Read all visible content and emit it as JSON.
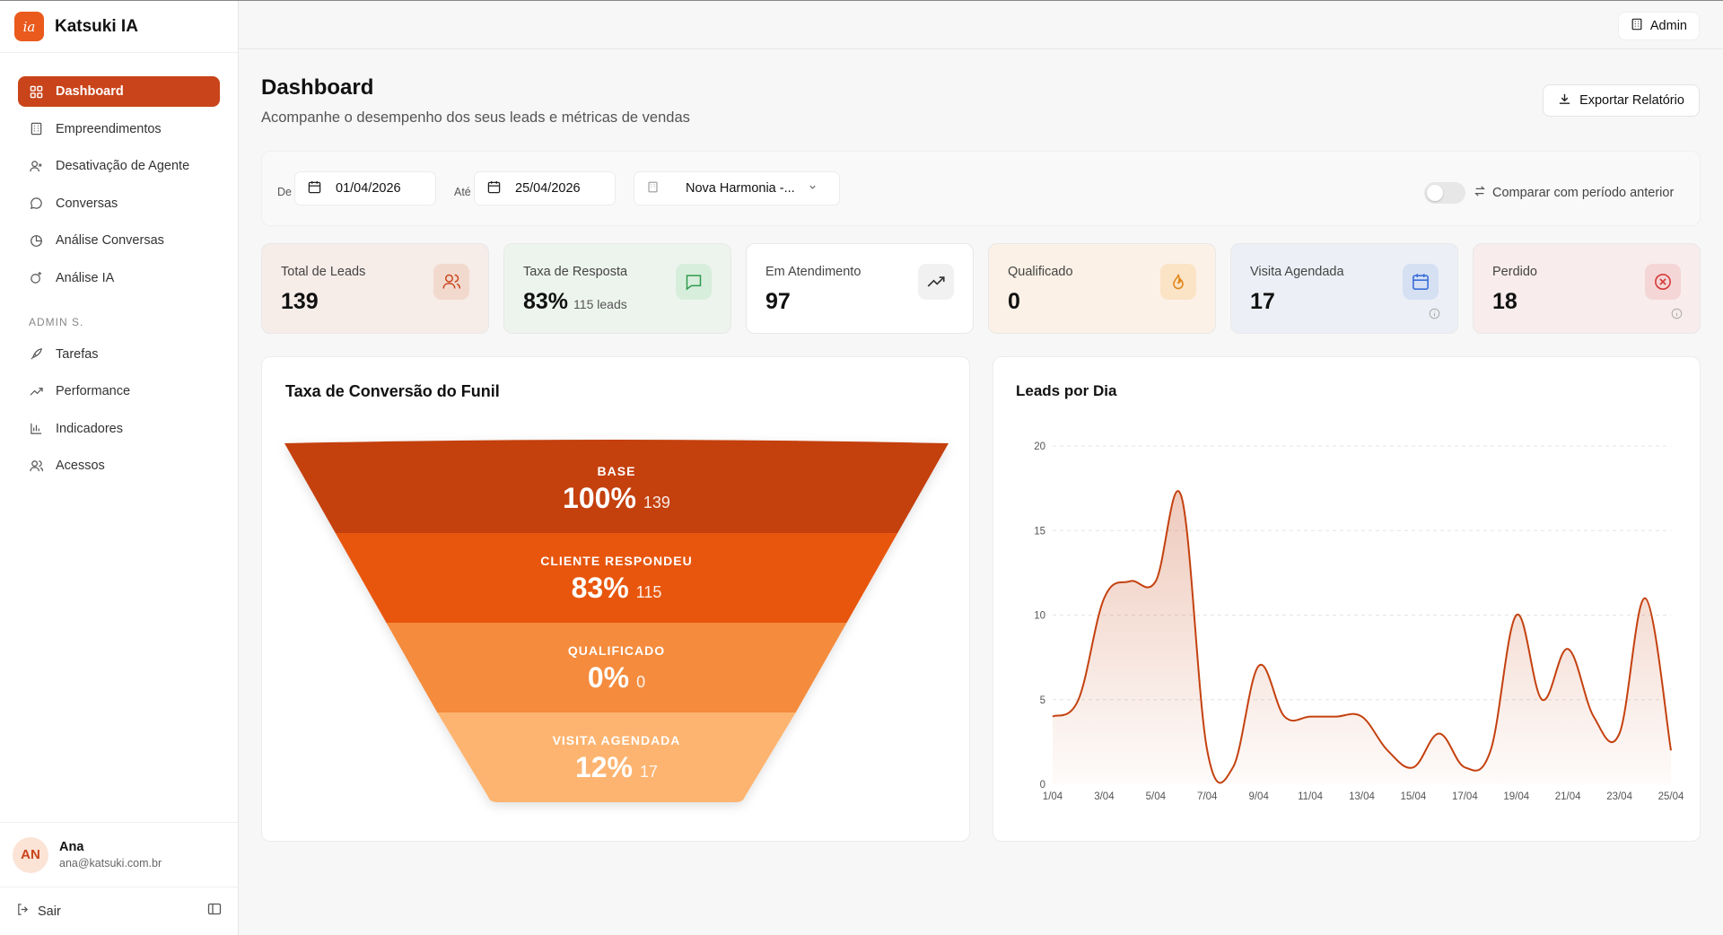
{
  "brand": {
    "logo_text": "ia",
    "name": "Katsuki IA",
    "accent": "#c9441a"
  },
  "sidebar": {
    "items": [
      {
        "label": "Dashboard",
        "icon": "grid-icon",
        "active": true
      },
      {
        "label": "Empreendimentos",
        "icon": "building-icon"
      },
      {
        "label": "Desativação de Agente",
        "icon": "user-x-icon"
      },
      {
        "label": "Conversas",
        "icon": "chat-icon"
      },
      {
        "label": "Análise Conversas",
        "icon": "pie-chart-icon"
      },
      {
        "label": "Análise IA",
        "icon": "sparkle-icon"
      }
    ],
    "admin_section_label": "ADMIN S.",
    "admin_items": [
      {
        "label": "Tarefas",
        "icon": "rocket-icon"
      },
      {
        "label": "Performance",
        "icon": "trend-icon"
      },
      {
        "label": "Indicadores",
        "icon": "bar-chart-icon"
      },
      {
        "label": "Acessos",
        "icon": "users-icon"
      }
    ],
    "user": {
      "initials": "AN",
      "name": "Ana",
      "email": "ana@katsuki.com.br"
    },
    "logout_label": "Sair"
  },
  "header": {
    "admin_label": "Admin"
  },
  "page": {
    "title": "Dashboard",
    "subtitle": "Acompanhe o desempenho dos seus leads e métricas de vendas",
    "export_label": "Exportar Relatório"
  },
  "filters": {
    "from_label": "De",
    "from_value": "01/04/2026",
    "to_label": "Até",
    "to_value": "25/04/2026",
    "project_value": "Nova Harmonia -...",
    "compare_label": "Comparar com período anterior",
    "compare_enabled": false
  },
  "metrics": [
    {
      "label": "Total de Leads",
      "value": "139",
      "sub": "",
      "icon": "users-icon",
      "bg": "#f6ece8",
      "icon_bg": "#f2d9ce",
      "icon_color": "#c9441a"
    },
    {
      "label": "Taxa de Resposta",
      "value": "83%",
      "sub": "115 leads",
      "icon": "message-icon",
      "bg": "#edf4ee",
      "icon_bg": "#d8eedc",
      "icon_color": "#2e9a4e"
    },
    {
      "label": "Em Atendimento",
      "value": "97",
      "sub": "",
      "icon": "trend-up-icon",
      "bg": "#ffffff",
      "icon_bg": "#f1f1f1",
      "icon_color": "#333333"
    },
    {
      "label": "Qualificado",
      "value": "0",
      "sub": "",
      "icon": "flame-icon",
      "bg": "#fbf1e6",
      "icon_bg": "#fbe3c6",
      "icon_color": "#e08a1e"
    },
    {
      "label": "Visita Agendada",
      "value": "17",
      "sub": "",
      "icon": "calendar-icon",
      "bg": "#ecf0f6",
      "icon_bg": "#d5e0f3",
      "icon_color": "#3b6fd8"
    },
    {
      "label": "Perdido",
      "value": "18",
      "sub": "",
      "icon": "x-circle-icon",
      "bg": "#f8ecec",
      "icon_bg": "#f5d6d6",
      "icon_color": "#d63b3b"
    }
  ],
  "funnel": {
    "title": "Taxa de Conversão do Funil",
    "stages": [
      {
        "label": "BASE",
        "percent": "100%",
        "count": "139",
        "color": "#c4410f"
      },
      {
        "label": "CLIENTE RESPONDEU",
        "percent": "83%",
        "count": "115",
        "color": "#e8560f"
      },
      {
        "label": "QUALIFICADO",
        "percent": "0%",
        "count": "0",
        "color": "#f48b3c"
      },
      {
        "label": "VISITA AGENDADA",
        "percent": "12%",
        "count": "17",
        "color": "#fdb46f"
      }
    ]
  },
  "chart_data": {
    "type": "area",
    "title": "Leads por Dia",
    "x": [
      "1/04",
      "2/04",
      "3/04",
      "4/04",
      "5/04",
      "6/04",
      "7/04",
      "8/04",
      "9/04",
      "10/04",
      "11/04",
      "12/04",
      "13/04",
      "14/04",
      "15/04",
      "16/04",
      "17/04",
      "18/04",
      "19/04",
      "20/04",
      "21/04",
      "22/04",
      "23/04",
      "24/04",
      "25/04"
    ],
    "x_tick_labels": [
      "1/04",
      "3/04",
      "5/04",
      "7/04",
      "9/04",
      "11/04",
      "13/04",
      "15/04",
      "17/04",
      "19/04",
      "21/04",
      "23/04",
      "25/04"
    ],
    "series": [
      {
        "values": [
          4,
          5,
          11,
          12,
          12,
          17,
          2,
          1,
          7,
          4,
          4,
          4,
          4,
          2,
          1,
          3,
          1,
          2,
          10,
          5,
          8,
          4,
          3,
          11,
          2
        ]
      }
    ],
    "ylim": [
      0,
      20
    ],
    "y_ticks": [
      0,
      5,
      10,
      15,
      20
    ],
    "grid": true,
    "line_color": "#c4410f"
  }
}
